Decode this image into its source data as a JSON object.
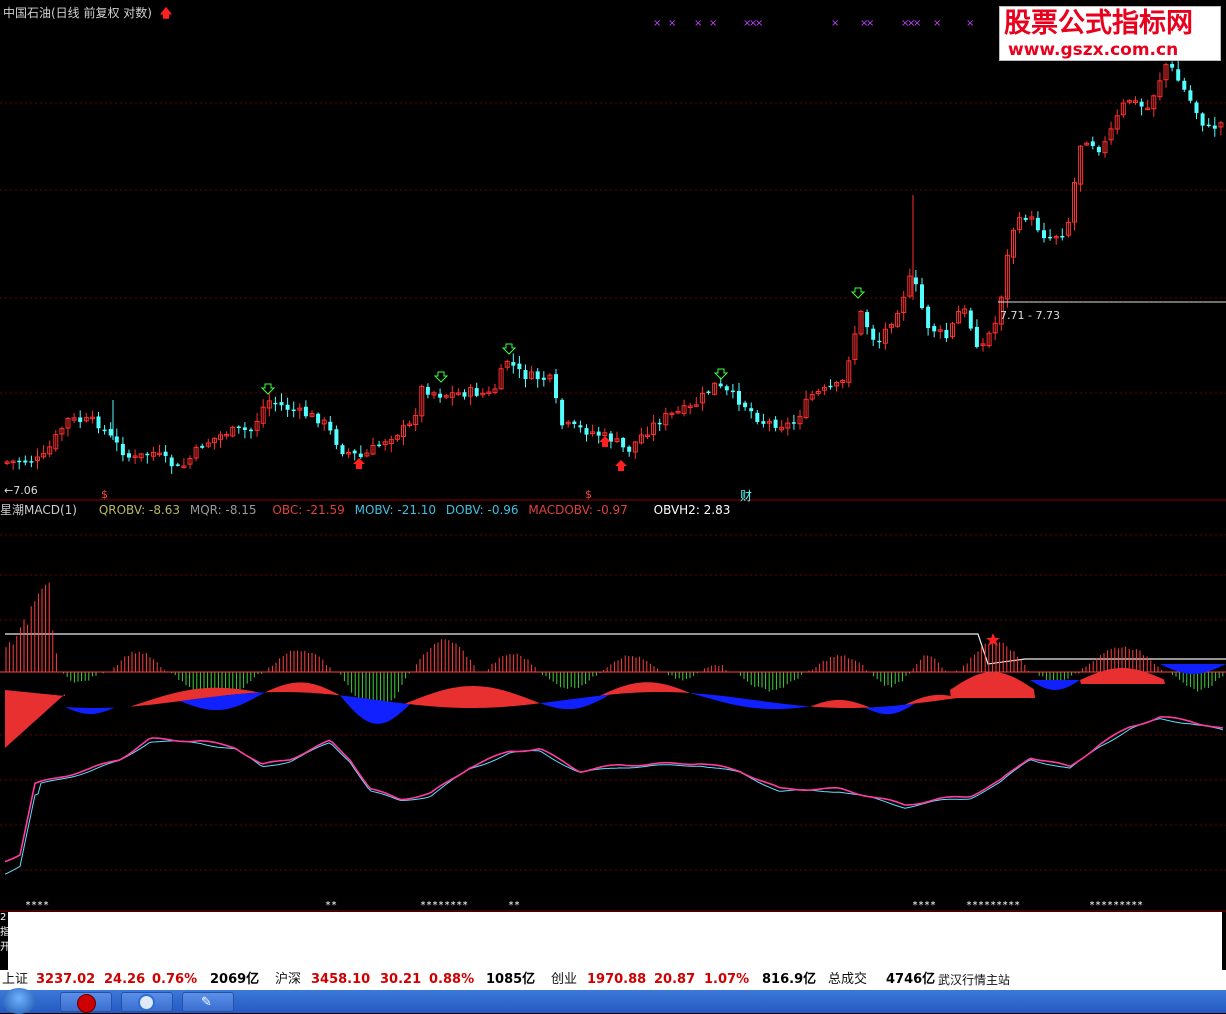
{
  "price_panel": {
    "title": "中国石油(日线 前复权 对数)",
    "low_label": "←7.06",
    "range_label": "7.71 - 7.73",
    "markers": {
      "dollar_1": "$",
      "dollar_2": "$",
      "cai": "财"
    }
  },
  "indicator": {
    "name": "星潮MACD(1)",
    "items": [
      {
        "label": "QROBV: -8.63",
        "color": "#b8b860"
      },
      {
        "label": "MQR: -8.15",
        "color": "#999999"
      },
      {
        "label": "OBC: -21.59",
        "color": "#e04040"
      },
      {
        "label": "MOBV: -21.10",
        "color": "#40c0e0"
      },
      {
        "label": "DOBV: -0.96",
        "color": "#40c0e0"
      },
      {
        "label": "MACDOBV: -0.97",
        "color": "#e04040"
      },
      {
        "label": "OBVH2: 2.83",
        "color": "#ffffff"
      }
    ]
  },
  "logo": {
    "line1": "股票公式指标网",
    "line2": "www.gszx.com.cn"
  },
  "left_strip": [
    "2",
    "指",
    "开"
  ],
  "status_bar": {
    "sh_label": "上证",
    "sh_value": "3237.02",
    "sh_change": "24.26",
    "sh_pct": "0.76%",
    "sh_amount": "2069亿",
    "hs_label": "沪深",
    "hs_value": "3458.10",
    "hs_change": "30.21",
    "hs_pct": "0.88%",
    "hs_amount": "1085亿",
    "cy_label": "创业",
    "cy_value": "1970.88",
    "cy_change": "20.87",
    "cy_pct": "1.07%",
    "cy_amount": "816.9亿",
    "total_label": "总成交",
    "total_amount": "4746亿",
    "station": "武汉行情主站"
  },
  "colors": {
    "up": "#ff3030",
    "down": "#54ffff",
    "grid": "#6a0000",
    "purple": "#c040ff"
  },
  "icons": [
    "start-orb-icon",
    "taskbar-app-icon",
    "browser-icon",
    "feather-icon",
    "up-arrow-icon",
    "down-arrow-icon",
    "star-icon"
  ]
}
